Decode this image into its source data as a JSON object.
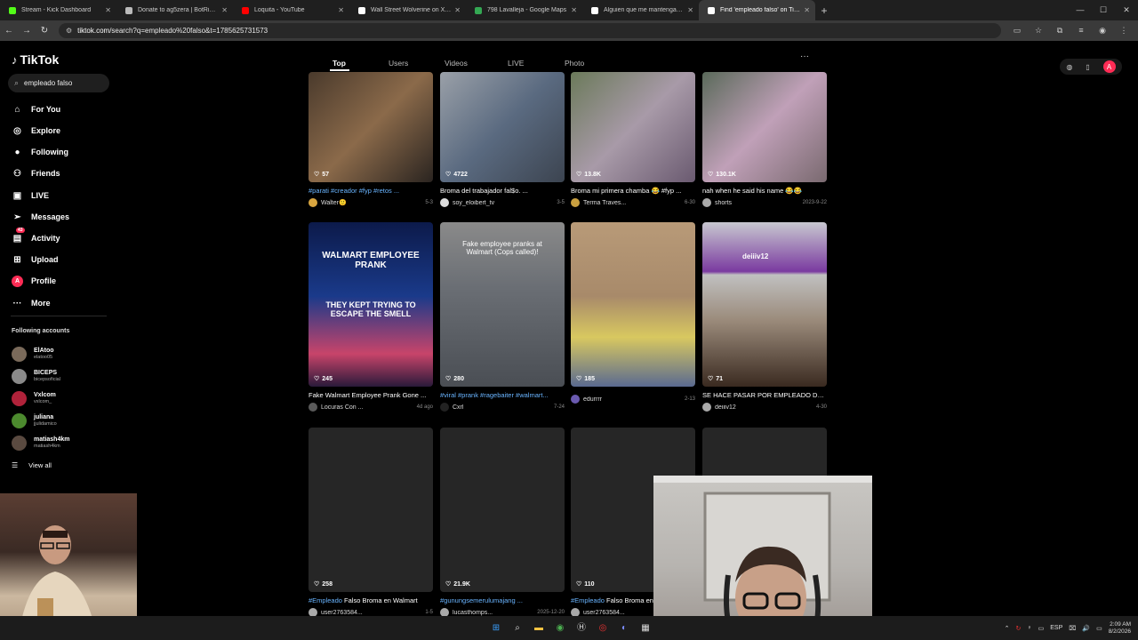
{
  "browser": {
    "tabs": [
      {
        "title": "Stream - Kick Dashboard",
        "color": "#53fc18"
      },
      {
        "title": "Donate to ag5zera | BotRix - C",
        "color": "#bbbbbb"
      },
      {
        "title": "Loquita - YouTube",
        "color": "#ff0000"
      },
      {
        "title": "Wall Street Wolverine on X: \"Im",
        "color": "#ffffff"
      },
      {
        "title": "798 Lavalleja - Google Maps",
        "color": "#34a853"
      },
      {
        "title": "Alguien que me mantenga: por",
        "color": "#ffffff"
      },
      {
        "title": "Find 'empleado falso' on TikTok",
        "color": "#ffffff"
      }
    ],
    "new_tab": "+",
    "url_host": "tiktok.com",
    "url_path": "/search?q=empleado%20falso&t=1785625731573"
  },
  "sidebar": {
    "logo": "TikTok",
    "search_value": "empleado falso",
    "nav": [
      {
        "label": "For You",
        "icon": "home-icon",
        "glyph": "⌂"
      },
      {
        "label": "Explore",
        "icon": "compass-icon",
        "glyph": "◎"
      },
      {
        "label": "Following",
        "icon": "following-icon",
        "glyph": "●"
      },
      {
        "label": "Friends",
        "icon": "friends-icon",
        "glyph": "⚇"
      },
      {
        "label": "LIVE",
        "icon": "live-icon",
        "glyph": "▣"
      },
      {
        "label": "Messages",
        "icon": "messages-icon",
        "glyph": "➢"
      },
      {
        "label": "Activity",
        "icon": "activity-icon",
        "glyph": "▤",
        "badge": "43"
      },
      {
        "label": "Upload",
        "icon": "upload-icon",
        "glyph": "⊞"
      },
      {
        "label": "Profile",
        "icon": "profile-icon",
        "glyph": "A"
      },
      {
        "label": "More",
        "icon": "more-icon",
        "glyph": "···"
      }
    ],
    "following_title": "Following accounts",
    "accounts": [
      {
        "name": "ElAtoo",
        "handle": "elatoo05",
        "color": "#7a6a5a"
      },
      {
        "name": "BICEPS",
        "handle": "bicepsoficial",
        "color": "#8a8a8a"
      },
      {
        "name": "Vxlcom",
        "handle": "vxlcom_",
        "color": "#b0223a"
      },
      {
        "name": "juliana",
        "handle": "jjulidamico",
        "color": "#4c8a2e"
      },
      {
        "name": "matiash4km",
        "handle": "matiash4km",
        "color": "#5a4a40"
      }
    ],
    "view_all": "View all"
  },
  "search_tabs": [
    "Top",
    "Users",
    "Videos",
    "LIVE",
    "Photo"
  ],
  "videos": [
    {
      "likes": "57",
      "tag": "#parati #creador #fyp #retos ...",
      "caption": "",
      "user": "Walter🙂",
      "date": "5-3",
      "bg": "linear-gradient(135deg,#4a3a2c,#8b6a4a 50%,#2a2420)",
      "avc": "#d9a640"
    },
    {
      "likes": "4722",
      "tag": "",
      "caption": "Broma del trabajador fal$o. ...",
      "user": "soy_eloibert_tv",
      "date": "3-5",
      "bg": "linear-gradient(135deg,#9aa0a8,#5a6a80 50%,#3c4450)",
      "avc": "#dddddd"
    },
    {
      "likes": "13.8K",
      "tag": "",
      "caption": "Broma mi primera chamba 😂 #fyp ...",
      "user": "Terma Traves...",
      "date": "6-30",
      "bg": "linear-gradient(135deg,#6b7a5a,#a89aa8 50%,#6a5a70)",
      "avc": "#c9a040"
    },
    {
      "likes": "130.1K",
      "tag": "",
      "caption": "nah when he said his name 😂😂",
      "user": "shorts",
      "date": "2023-9-22",
      "bg": "linear-gradient(135deg,#5a6a5a,#c0a0b8 50%,#7a6a70)",
      "avc": "#aaaaaa"
    },
    {
      "likes": "245",
      "tag": "",
      "caption": "Fake Walmart Employee Prank Gone ...",
      "user": "Locuras Con ...",
      "date": "4d ago",
      "bg": "linear-gradient(180deg,#0c1a4a,#1a3a8a 45%,#c8446a 80%,#2a1a3a)",
      "avc": "#5a5a5a",
      "overlay1": "WALMART EMPLOYEE PRANK",
      "overlay2": "THEY KEPT TRYING TO ESCAPE THE SMELL"
    },
    {
      "likes": "280",
      "tag": "#viral #prank #ragebaiter #walmart...",
      "caption": "",
      "user": "Cxrl",
      "date": "7-24",
      "bg": "linear-gradient(180deg,#8a8a8a,#6a6e74 40%,#4a4e54)",
      "avc": "#222222",
      "overlay1": "Fake employee pranks at Walmart (Cops called)!"
    },
    {
      "likes": "185",
      "tag": "",
      "caption": "",
      "user": "edurrrr",
      "date": "2-13",
      "bg": "linear-gradient(180deg,#b89a78,#a88a6a 45%,#d8c860 70%,#5a6a90)",
      "avc": "#6a5ab0"
    },
    {
      "likes": "71",
      "tag": "",
      "caption": "SE HACE PASAR POR EMPLEADO DE...",
      "user": "deiiiv12",
      "date": "4-30",
      "bg": "linear-gradient(180deg,#c8c8d0,#7a3aa0 30%,#c0c0c0 32%,#9a8a7a 60%,#3a2a20)",
      "avc": "#aaaaaa",
      "overlay1": "deiiiv12"
    },
    {
      "likes": "258",
      "tag": "#Empleado",
      "caption": " Falso Broma en Walmart",
      "user": "user2763584...",
      "date": "1-5",
      "bg": "#262626",
      "avc": "#aaaaaa"
    },
    {
      "likes": "21.9K",
      "tag": "#gunungsemerulumajang ...",
      "caption": "",
      "user": "lucasthomps...",
      "date": "2025-12-20",
      "bg": "#262626",
      "avc": "#aaaaaa"
    },
    {
      "likes": "110",
      "tag": "#Empleado",
      "caption": " Falso Broma en ...",
      "user": "user2763584...",
      "date": "",
      "bg": "#262626",
      "avc": "#aaaaaa"
    },
    {
      "likes": "",
      "tag": "",
      "caption": "",
      "user": "",
      "date": "",
      "bg": "#262626",
      "avc": "transparent"
    }
  ],
  "taskbar": {
    "lang": "ESP",
    "time": "2:09 AM",
    "date": "8/2/2026"
  }
}
